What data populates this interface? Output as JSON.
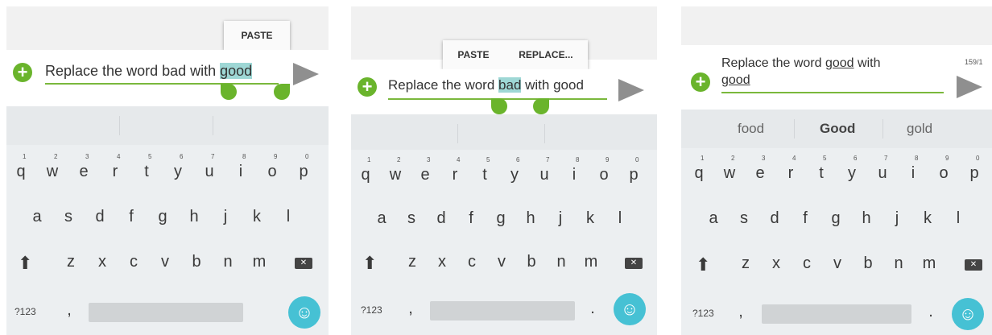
{
  "panels": [
    {
      "popup": [
        "PASTE"
      ],
      "text_before": "Replace the word bad with ",
      "text_selected": "good",
      "text_after": "",
      "suggestions": [
        "",
        "",
        ""
      ]
    },
    {
      "popup": [
        "PASTE",
        "REPLACE..."
      ],
      "text_before": "Replace the word ",
      "text_selected": "bad",
      "text_after": " with good",
      "suggestions": [
        "",
        "",
        ""
      ]
    },
    {
      "line1_before": "Replace the word ",
      "line1_underlined": "good",
      "line1_after": " with",
      "line2_underlined": "good",
      "counter": "159/1",
      "suggestions": [
        "food",
        "Good",
        "gold"
      ]
    }
  ],
  "keyboard": {
    "row1": [
      [
        "q",
        "1"
      ],
      [
        "w",
        "2"
      ],
      [
        "e",
        "3"
      ],
      [
        "r",
        "4"
      ],
      [
        "t",
        "5"
      ],
      [
        "y",
        "6"
      ],
      [
        "u",
        "7"
      ],
      [
        "i",
        "8"
      ],
      [
        "o",
        "9"
      ],
      [
        "p",
        "0"
      ]
    ],
    "row2": [
      "a",
      "s",
      "d",
      "f",
      "g",
      "h",
      "j",
      "k",
      "l"
    ],
    "row3": [
      "z",
      "x",
      "c",
      "v",
      "b",
      "n",
      "m"
    ],
    "symbols_key": "?123",
    "comma": ",",
    "period": ".",
    "backspace_glyph": "✕",
    "emoji_glyph": "☺",
    "shift_glyph": "⬆"
  }
}
